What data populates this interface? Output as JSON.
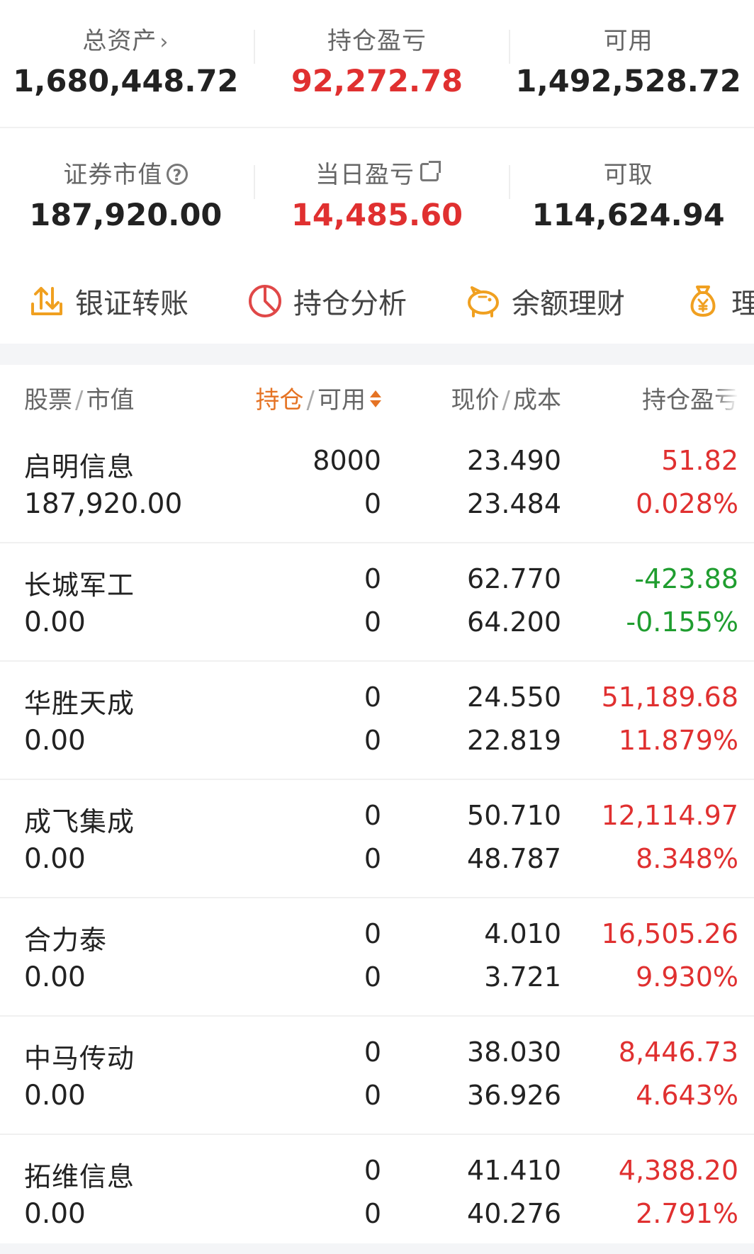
{
  "summary": {
    "total_assets_label": "总资产",
    "total_assets_value": "1,680,448.72",
    "position_pl_label": "持仓盈亏",
    "position_pl_value": "92,272.78",
    "available_label": "可用",
    "available_value": "1,492,528.72",
    "market_value_label": "证券市值",
    "market_value_value": "187,920.00",
    "daily_pl_label": "当日盈亏",
    "daily_pl_value": "14,485.60",
    "withdrawable_label": "可取",
    "withdrawable_value": "114,624.94",
    "chevron_glyph": "›",
    "help_glyph": "?"
  },
  "quick_actions": [
    {
      "label": "银证转账",
      "icon": "transfer-icon"
    },
    {
      "label": "持仓分析",
      "icon": "pie-chart-icon"
    },
    {
      "label": "余额理财",
      "icon": "piggy-bank-icon"
    },
    {
      "label": "理财",
      "icon": "money-bag-icon"
    }
  ],
  "table": {
    "col_stock": "股票",
    "col_market_value": "市值",
    "col_position": "持仓",
    "col_available": "可用",
    "col_price": "现价",
    "col_cost": "成本",
    "col_pl": "持仓盈亏",
    "slash": "/",
    "rows": [
      {
        "name": "启明信息",
        "market_value": "187,920.00",
        "position": "8000",
        "available": "0",
        "price": "23.490",
        "cost": "23.484",
        "pl": "51.82",
        "pl_pct": "0.028%",
        "trend": "up"
      },
      {
        "name": "长城军工",
        "market_value": "0.00",
        "position": "0",
        "available": "0",
        "price": "62.770",
        "cost": "64.200",
        "pl": "-423.88",
        "pl_pct": "-0.155%",
        "trend": "down"
      },
      {
        "name": "华胜天成",
        "market_value": "0.00",
        "position": "0",
        "available": "0",
        "price": "24.550",
        "cost": "22.819",
        "pl": "51,189.68",
        "pl_pct": "11.879%",
        "trend": "up"
      },
      {
        "name": "成飞集成",
        "market_value": "0.00",
        "position": "0",
        "available": "0",
        "price": "50.710",
        "cost": "48.787",
        "pl": "12,114.97",
        "pl_pct": "8.348%",
        "trend": "up"
      },
      {
        "name": "合力泰",
        "market_value": "0.00",
        "position": "0",
        "available": "0",
        "price": "4.010",
        "cost": "3.721",
        "pl": "16,505.26",
        "pl_pct": "9.930%",
        "trend": "up"
      },
      {
        "name": "中马传动",
        "market_value": "0.00",
        "position": "0",
        "available": "0",
        "price": "38.030",
        "cost": "36.926",
        "pl": "8,446.73",
        "pl_pct": "4.643%",
        "trend": "up"
      },
      {
        "name": "拓维信息",
        "market_value": "0.00",
        "position": "0",
        "available": "0",
        "price": "41.410",
        "cost": "40.276",
        "pl": "4,388.20",
        "pl_pct": "2.791%",
        "trend": "up"
      }
    ]
  },
  "colors": {
    "up": "#e03030",
    "down": "#1f9d2f",
    "accent": "#e57324",
    "icon_orange": "#f0a020",
    "icon_red": "#e04848"
  }
}
